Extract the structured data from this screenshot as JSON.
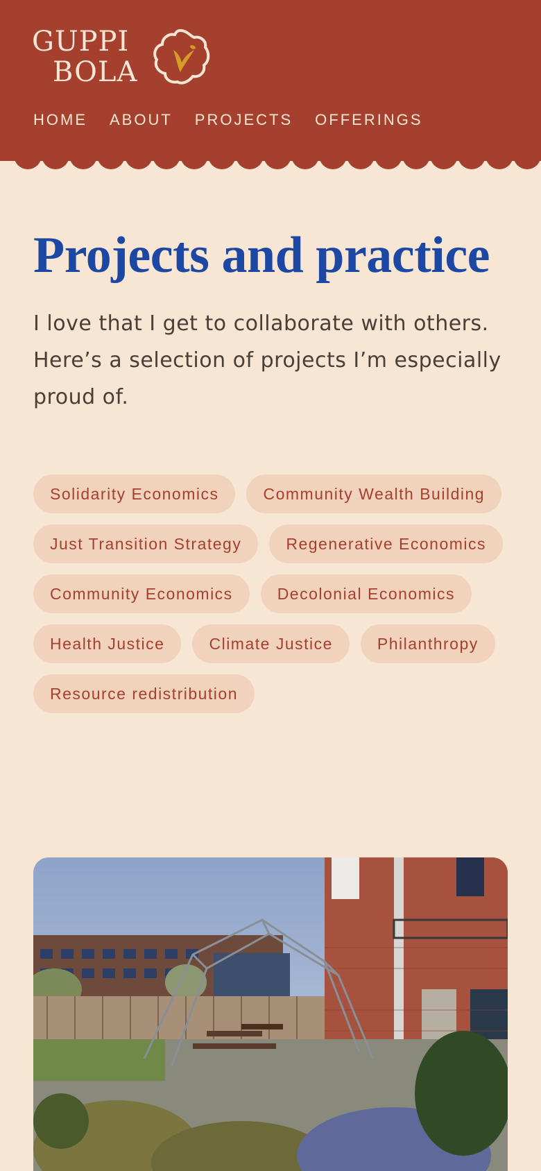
{
  "header": {
    "logo_line1": "GUPPI",
    "logo_line2": "BOLA",
    "nav": [
      "HOME",
      "ABOUT",
      "PROJECTS",
      "OFFERINGS"
    ],
    "colors": {
      "background": "#a5402e",
      "text": "#f8e6d4",
      "logo_accent": "#d79b2a"
    }
  },
  "main": {
    "title": "Projects and practice",
    "intro": "I love that I get to collaborate with others. Here’s a selection of projects I’m especially proud of.",
    "tags": [
      "Solidarity Economics",
      "Community Wealth Building",
      "Just Transition Strategy",
      "Regenerative Economics",
      "Community Economics",
      "Decolonial Economics",
      "Health Justice",
      "Climate Justice",
      "Philanthropy",
      "Resource redistribution"
    ],
    "colors": {
      "title": "#1c47a3",
      "page_background": "#f8e6d4",
      "tag_background": "#f0d2bd",
      "tag_text": "#a5402e"
    }
  },
  "photo": {
    "icon": "project-photo-courtyard-garden"
  }
}
